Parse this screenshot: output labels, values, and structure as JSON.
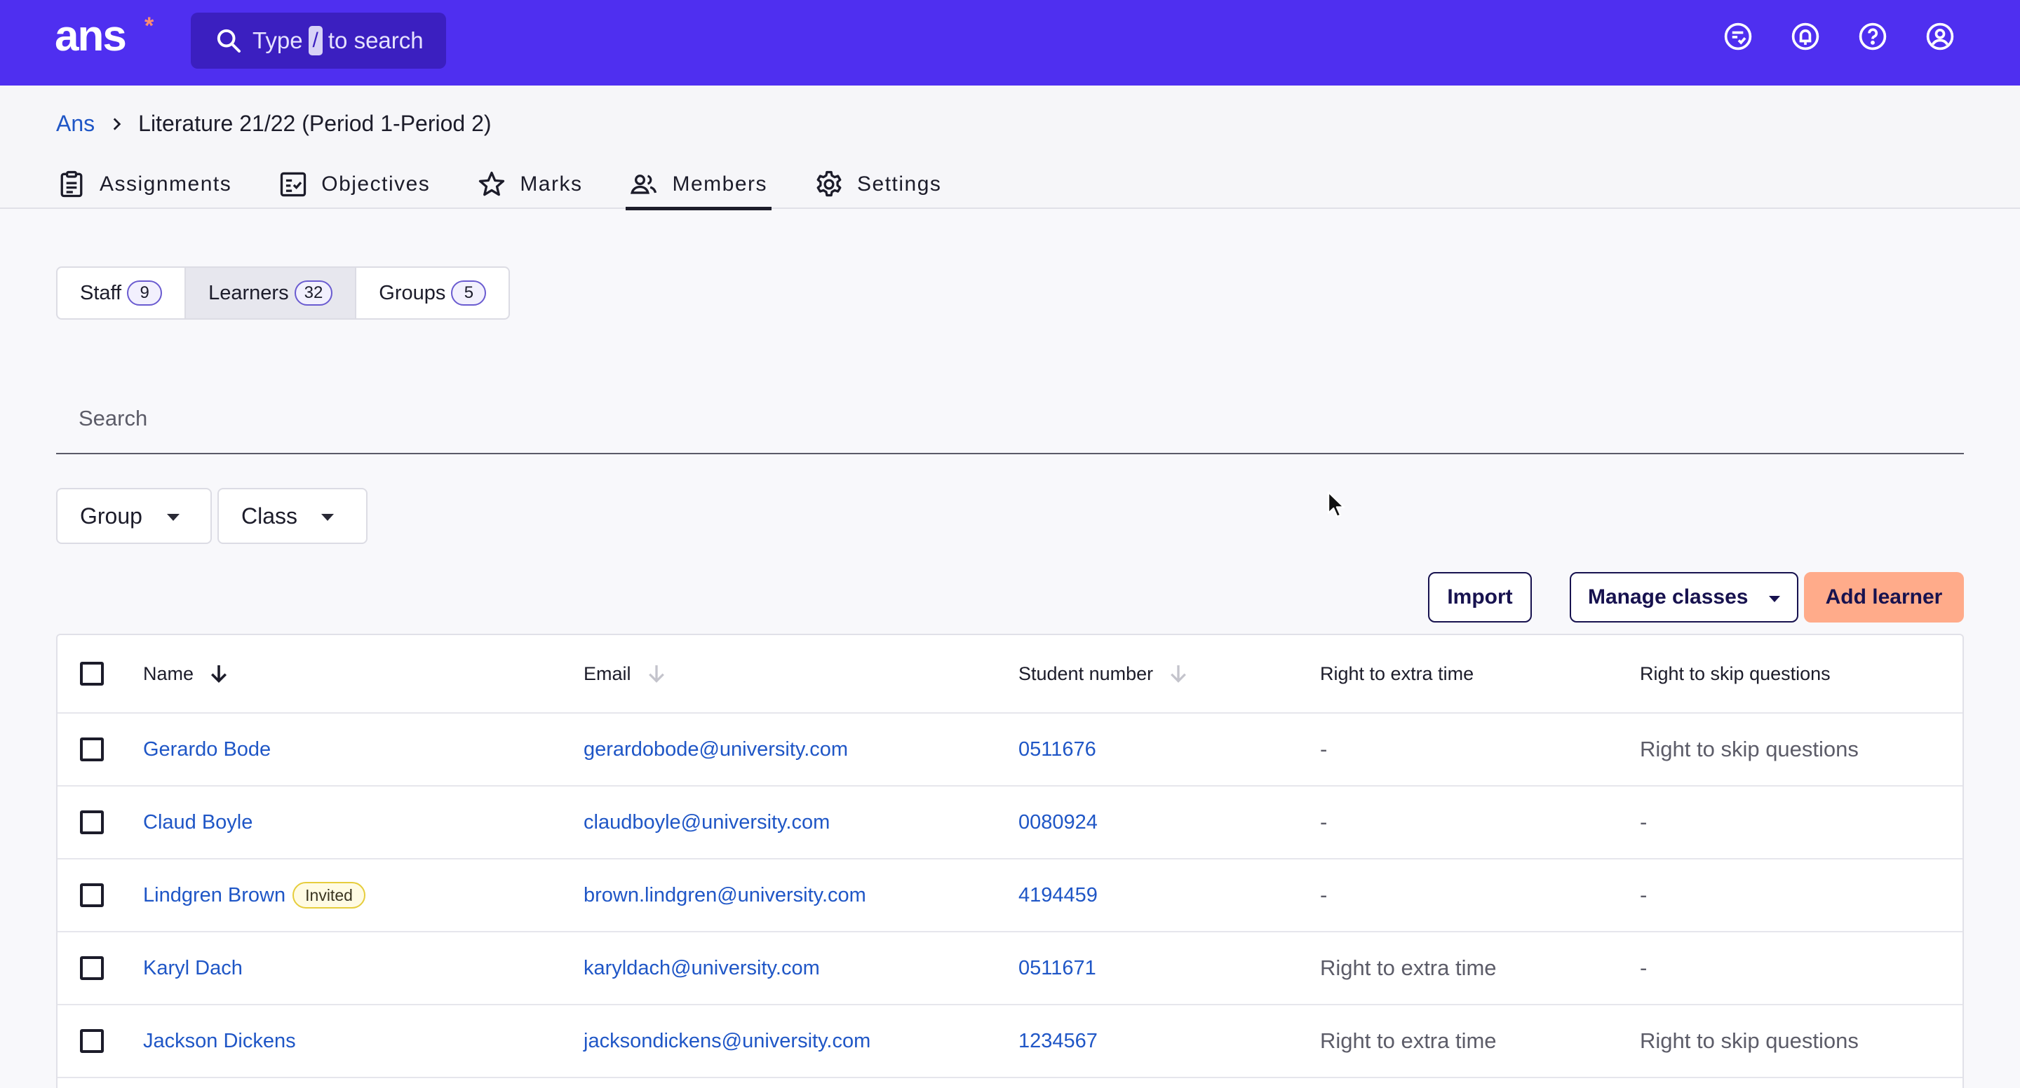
{
  "topbar": {
    "logo_text": "ans",
    "logo_star": "*",
    "search_prefix": "Type",
    "search_key": "/",
    "search_suffix": "to search",
    "icons": [
      "chat-check-icon",
      "notification-bell-icon",
      "help-icon",
      "account-icon"
    ],
    "brand_color": "#4f2ff0"
  },
  "breadcrumb": {
    "root": "Ans",
    "current": "Literature 21/22 (Period 1-Period 2)"
  },
  "navtabs": [
    {
      "label": "Assignments",
      "icon": "clipboard-icon"
    },
    {
      "label": "Objectives",
      "icon": "checklist-icon"
    },
    {
      "label": "Marks",
      "icon": "star-icon"
    },
    {
      "label": "Members",
      "icon": "people-icon",
      "active": true
    },
    {
      "label": "Settings",
      "icon": "gear-icon"
    }
  ],
  "segments": [
    {
      "label": "Staff",
      "count": "9"
    },
    {
      "label": "Learners",
      "count": "32",
      "active": true
    },
    {
      "label": "Groups",
      "count": "5"
    }
  ],
  "search": {
    "placeholder": "Search",
    "value": ""
  },
  "filters": {
    "group": "Group",
    "class": "Class"
  },
  "actions": {
    "import": "Import",
    "manage_classes": "Manage classes",
    "add_learner": "Add learner",
    "accent_color": "#ffab8a"
  },
  "table": {
    "columns": {
      "name": "Name",
      "email": "Email",
      "student_number": "Student number",
      "extra_time": "Right to extra time",
      "skip_questions": "Right to skip questions"
    },
    "rows": [
      {
        "name": "Gerardo Bode",
        "badge": "",
        "email": "gerardobode@university.com",
        "student_number": "0511676",
        "extra_time": "-",
        "skip_questions": "Right to skip questions"
      },
      {
        "name": "Claud Boyle",
        "badge": "",
        "email": "claudboyle@university.com",
        "student_number": "0080924",
        "extra_time": "-",
        "skip_questions": "-"
      },
      {
        "name": "Lindgren Brown",
        "badge": "Invited",
        "email": "brown.lindgren@university.com",
        "student_number": "4194459",
        "extra_time": "-",
        "skip_questions": "-"
      },
      {
        "name": "Karyl Dach",
        "badge": "",
        "email": "karyldach@university.com",
        "student_number": "0511671",
        "extra_time": "Right to extra time",
        "skip_questions": "-"
      },
      {
        "name": "Jackson Dickens",
        "badge": "",
        "email": "jacksondickens@university.com",
        "student_number": "1234567",
        "extra_time": "Right to extra time",
        "skip_questions": "Right to skip questions"
      }
    ]
  }
}
